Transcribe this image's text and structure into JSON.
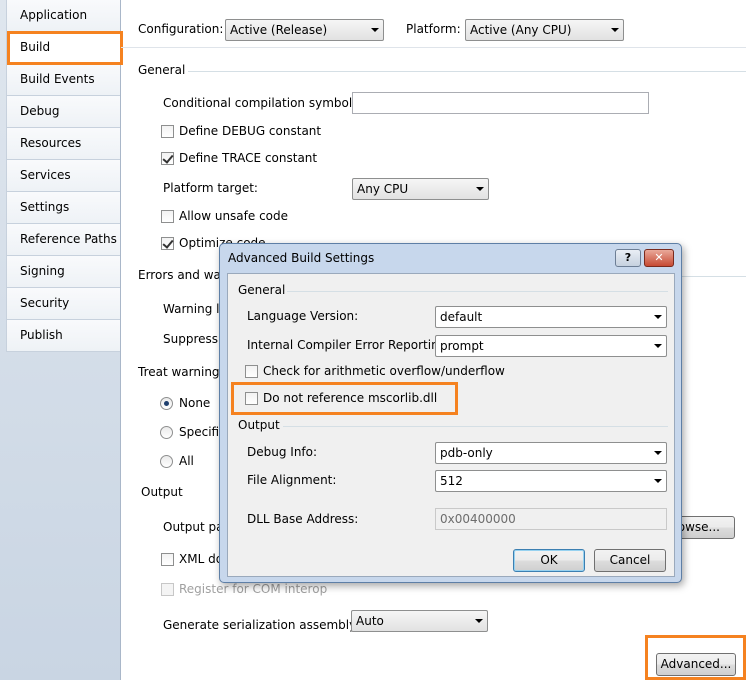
{
  "tabs": [
    {
      "label": "Application"
    },
    {
      "label": "Build"
    },
    {
      "label": "Build Events"
    },
    {
      "label": "Debug"
    },
    {
      "label": "Resources"
    },
    {
      "label": "Services"
    },
    {
      "label": "Settings"
    },
    {
      "label": "Reference Paths"
    },
    {
      "label": "Signing"
    },
    {
      "label": "Security"
    },
    {
      "label": "Publish"
    }
  ],
  "top": {
    "configuration_label": "Configuration:",
    "configuration_value": "Active (Release)",
    "platform_label": "Platform:",
    "platform_value": "Active (Any CPU)"
  },
  "general": {
    "header": "General",
    "conditional_symbols_label": "Conditional compilation symbols:",
    "conditional_symbols_value": "",
    "define_debug": "Define DEBUG constant",
    "define_trace": "Define TRACE constant",
    "platform_target_label": "Platform target:",
    "platform_target_value": "Any CPU",
    "allow_unsafe": "Allow unsafe code",
    "optimize_code": "Optimize code"
  },
  "errors": {
    "header": "Errors and warni",
    "warning_level": "Warning le",
    "suppress": "Suppress w"
  },
  "treat_warnings": {
    "header": "Treat warnings",
    "none": "None",
    "specific": "Specific",
    "all": "All"
  },
  "output": {
    "header": "Output",
    "output_path": "Output pat",
    "browse": "rowse...",
    "xml_doc": "XML do",
    "register_com": "Register for COM interop",
    "gen_serialization_label": "Generate serialization assembly:",
    "gen_serialization_value": "Auto",
    "advanced_button": "Advanced..."
  },
  "dialog": {
    "title": "Advanced Build Settings",
    "help_button": "?",
    "close_button": "✕",
    "general_header": "General",
    "language_version_label": "Language Version:",
    "language_version_value": "default",
    "icer_label": "Internal Compiler Error Reporting:",
    "icer_value": "prompt",
    "check_overflow": "Check for arithmetic overflow/underflow",
    "no_mscorlib": "Do not reference mscorlib.dll",
    "output_header": "Output",
    "debug_info_label": "Debug Info:",
    "debug_info_value": "pdb-only",
    "file_alignment_label": "File Alignment:",
    "file_alignment_value": "512",
    "dll_base_label": "DLL Base Address:",
    "dll_base_value": "0x00400000",
    "ok": "OK",
    "cancel": "Cancel"
  },
  "colors": {
    "highlight": "#f58220",
    "dialog_frame": "#c7d7ec"
  }
}
